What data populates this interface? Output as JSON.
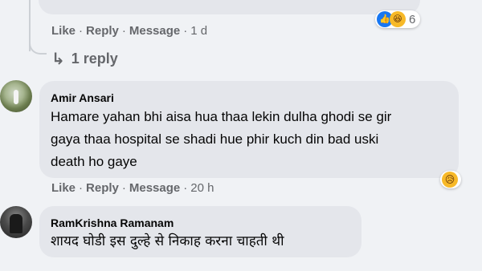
{
  "top_comment": {
    "actions": {
      "like": "Like",
      "reply": "Reply",
      "message": "Message",
      "time": "1 d"
    },
    "reactions": {
      "icons": [
        "like-icon",
        "haha-icon"
      ],
      "count": "6"
    },
    "replies_link": "1 reply"
  },
  "comments": [
    {
      "author": "Amir Ansari",
      "text_line1": "Hamare yahan bhi aisa hua thaa lekin dulha ghodi se gir",
      "text_line2": "gaya thaa hospital se shadi hue phir kuch din bad uski",
      "text_line3": "death ho gaye",
      "actions": {
        "like": "Like",
        "reply": "Reply",
        "message": "Message",
        "time": "20 h"
      },
      "reactions": {
        "icons": [
          "sad-icon"
        ]
      }
    },
    {
      "author": "RamKrishna Ramanam",
      "text": "शायद घोडी इस दुल्हे से निकाह करना चाहती थी"
    }
  ],
  "colors": {
    "background": "#f0f2f5",
    "bubble": "#e4e6eb",
    "secondary_text": "#65676b",
    "like_blue": "#1877f2",
    "emoji_yellow": "#f7b928"
  }
}
